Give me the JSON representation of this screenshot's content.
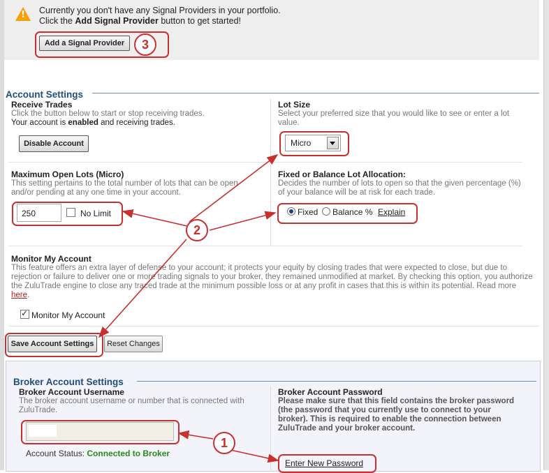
{
  "notice": {
    "line1": "Currently you don't have any Signal Providers in your portfolio.",
    "line2_prefix": "Click the ",
    "line2_bold": "Add Signal Provider",
    "line2_suffix": " button to get started!",
    "add_button": "Add a Signal Provider",
    "icon": "warning-icon"
  },
  "account_settings": {
    "title": "Account Settings",
    "receive_trades": {
      "heading": "Receive Trades",
      "desc": "Click the button below to start or stop receiving trades.",
      "status_prefix": "Your account is ",
      "status_bold": "enabled",
      "status_suffix": " and receiving trades.",
      "button": "Disable Account"
    },
    "lot_size": {
      "heading": "Lot Size",
      "desc": "Select your preferred size that you would like to see or enter a lot value.",
      "selected": "Micro"
    },
    "max_open_lots": {
      "heading": "Maximum Open Lots (Micro)",
      "desc": "This setting pertains to the total number of lots that can be open and/or pending at any one time in your account.",
      "value": "250",
      "no_limit_label": "No Limit",
      "no_limit_checked": false
    },
    "allocation": {
      "heading": "Fixed or Balance Lot Allocation:",
      "desc": "Decides the number of lots to open so that the given percentage (%) of your balance will be at risk for each trade.",
      "fixed_label": "Fixed",
      "balance_label": "Balance %",
      "selected": "Fixed",
      "explain_link": "Explain"
    },
    "monitor": {
      "heading": "Monitor My Account",
      "desc": "This feature offers an extra layer of defense to your account; it protects your equity by closing trades that were expected to close, but due to rejection or failure to deliver one or more trading signals to your broker, they remained unmodified at market. By checking this option, you authorize the ZuluTrade engine to close any traced trade at the minimum possible loss or at any profit in cases that this is within its potential. Read more ",
      "read_more_link": "here",
      "read_more_suffix": ".",
      "checkbox_label": "Monitor My Account",
      "checked": true
    },
    "save_button": "Save Account Settings",
    "reset_button": "Reset Changes"
  },
  "broker_settings": {
    "title": "Broker Account Settings",
    "username": {
      "heading": "Broker Account Username",
      "desc": "The broker account username or number that is connected with ZuluTrade.",
      "value": ""
    },
    "status_label": "Account Status: ",
    "status_value": "Connected to Broker",
    "password": {
      "heading": "Broker Account Password",
      "desc": "Please make sure that this field contains the broker password (the password that you currently use to connect to your broker). This is required to enable the connection between ZuluTrade and your broker account.",
      "link": "Enter New Password"
    }
  },
  "annotations": {
    "badge_1": "1",
    "badge_2": "2",
    "badge_3": "3"
  },
  "colors": {
    "annotation_red": "#c83030",
    "section_title": "#1f4f7a",
    "link": "#b22222",
    "status_ok": "#2a8a1e",
    "warning": "#f5a000"
  }
}
